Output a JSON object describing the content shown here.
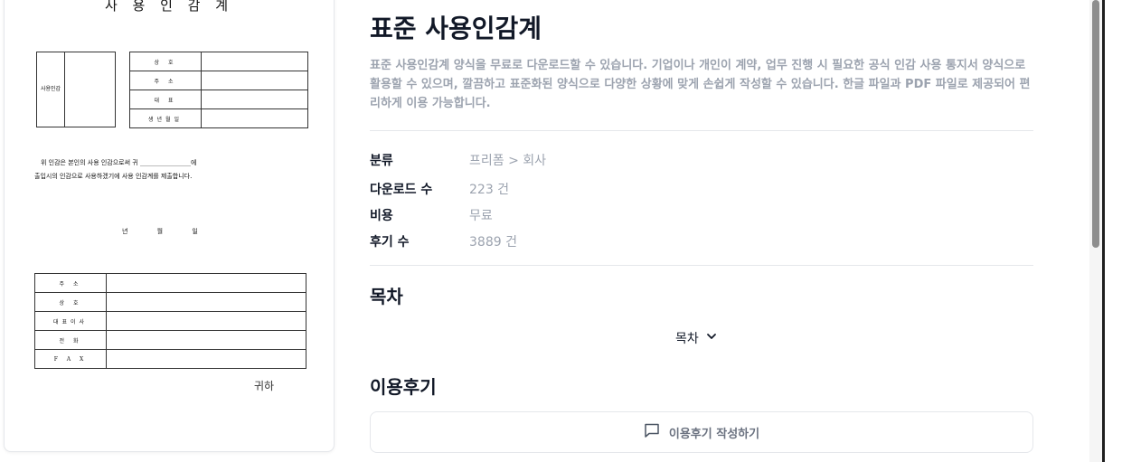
{
  "preview": {
    "doc_title": "사 용 인 감 계",
    "seal_label": "사용인감",
    "table_top": [
      "상 호",
      "주 소",
      "대 표",
      "생년월일"
    ],
    "pledge_line1": "위 인감은 본인의 사용 인감으로써 귀 ________________에",
    "pledge_line2": "출입시의 인감으로 사용하겠기에 사용 인감계를 제출합니다.",
    "date_line": "년 월 일",
    "table_bottom": [
      "주 소",
      "상 호",
      "대표이사",
      "전 화",
      "F A X"
    ],
    "addressee": "귀하"
  },
  "product": {
    "title": "표준 사용인감계",
    "description": "표준 사용인감계 양식을 무료로 다운로드할 수 있습니다. 기업이나 개인이 계약, 업무 진행 시 필요한 공식 인감 사용 통지서 양식으로 활용할 수 있으며, 깔끔하고 표준화된 양식으로 다양한 상황에 맞게 손쉽게 작성할 수 있습니다. 한글 파일과 PDF 파일로 제공되어 편리하게 이용 가능합니다."
  },
  "meta": {
    "category_label": "분류",
    "category_value": "프리폼 > 회사",
    "downloads_label": "다운로드 수",
    "downloads_value": "223 건",
    "cost_label": "비용",
    "cost_value": "무료",
    "reviews_label": "후기 수",
    "reviews_value": "3889 건"
  },
  "toc": {
    "section_title": "목차",
    "toggle_label": "목차"
  },
  "reviews": {
    "section_title": "이용후기",
    "write_button": "이용후기 작성하기"
  },
  "icons": {
    "toc_toggle": "chevron-down-icon",
    "review_button": "message-square-icon"
  },
  "colors": {
    "muted_text": "#9ca3af",
    "heading": "#111827",
    "border": "#e5e7eb"
  }
}
